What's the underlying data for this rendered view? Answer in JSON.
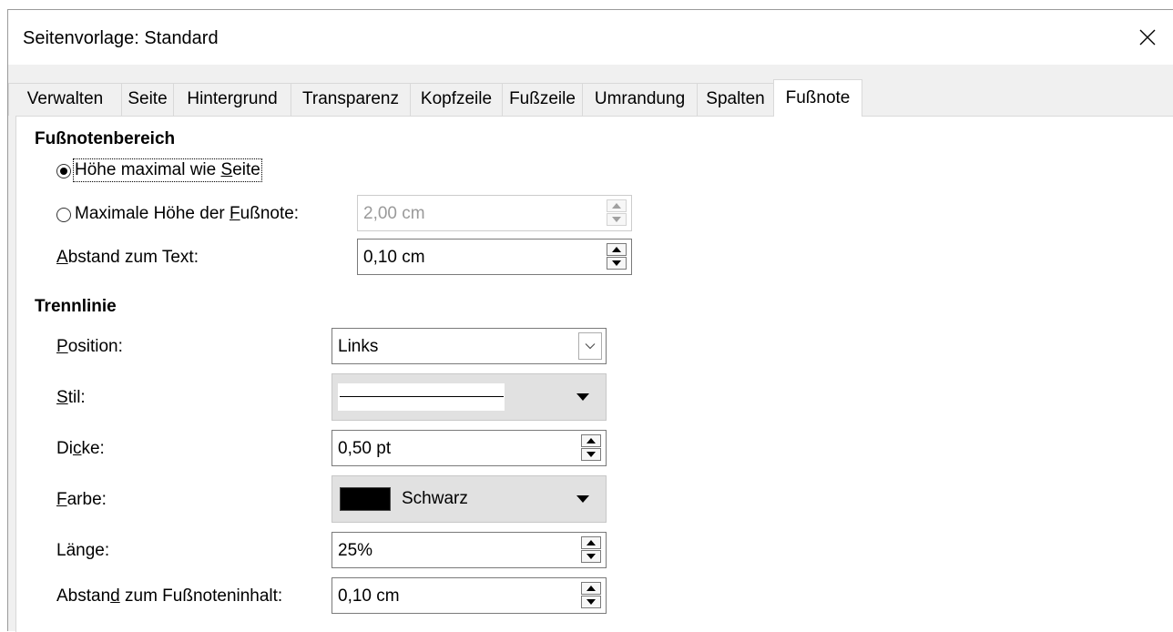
{
  "window": {
    "title": "Seitenvorlage: Standard"
  },
  "tabs": [
    "Verwalten",
    "Seite",
    "Hintergrund",
    "Transparenz",
    "Kopfzeile",
    "Fußzeile",
    "Umrandung",
    "Spalten",
    "Fußnote"
  ],
  "active_tab": "Fußnote",
  "footnote_area": {
    "heading": "Fußnotenbereich",
    "option_page": {
      "pre": "Höhe maximal wie ",
      "mn": "S",
      "post": "eite",
      "checked": true
    },
    "option_max": {
      "pre": "Maximale Höhe der ",
      "mn": "F",
      "post": "ußnote:",
      "checked": false,
      "value": "2,00 cm"
    },
    "spacing": {
      "mn": "A",
      "post": "bstand zum Text:",
      "value": "0,10 cm"
    }
  },
  "separator": {
    "heading": "Trennlinie",
    "position": {
      "mn": "P",
      "post": "osition:",
      "value": "Links"
    },
    "style": {
      "mn": "S",
      "post": "til:"
    },
    "thickness": {
      "pre": "Di",
      "mn": "c",
      "post": "ke:",
      "value": "0,50 pt"
    },
    "color": {
      "mn": "F",
      "post": "arbe:",
      "value": "Schwarz",
      "swatch": "#000000"
    },
    "length": {
      "pre": "Län",
      "mn": "g",
      "post": "e:",
      "value": "25%"
    },
    "spacing_content": {
      "pre": "Abstan",
      "mn": "d",
      "post": " zum Fußnoteninhalt:",
      "value": "0,10 cm"
    }
  }
}
